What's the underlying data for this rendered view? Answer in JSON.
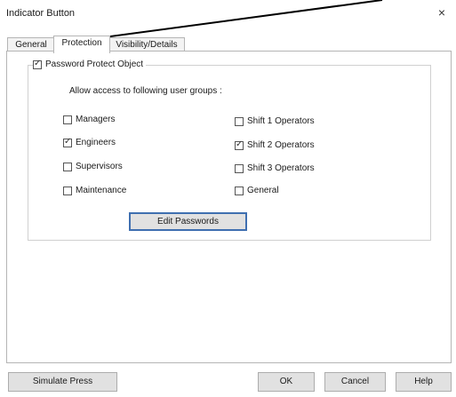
{
  "window": {
    "title": "Indicator Button",
    "close_glyph": "×"
  },
  "tabs": [
    {
      "label": "General"
    },
    {
      "label": "Protection"
    },
    {
      "label": "Visibility/Details"
    }
  ],
  "protection": {
    "password_protect": {
      "label": "Password Protect Object",
      "checked": true
    },
    "groups_label": "Allow access to following user groups :",
    "groups": [
      {
        "label": "Managers",
        "checked": false
      },
      {
        "label": "Engineers",
        "checked": true
      },
      {
        "label": "Supervisors",
        "checked": false
      },
      {
        "label": "Maintenance",
        "checked": false
      },
      {
        "label": "Shift 1 Operators",
        "checked": false
      },
      {
        "label": "Shift 2 Operators",
        "checked": true
      },
      {
        "label": "Shift 3 Operators",
        "checked": false
      },
      {
        "label": "General",
        "checked": false
      }
    ],
    "edit_passwords_label": "Edit Passwords"
  },
  "footer": {
    "simulate_press_label": "Simulate Press",
    "ok_label": "OK",
    "cancel_label": "Cancel",
    "help_label": "Help"
  }
}
